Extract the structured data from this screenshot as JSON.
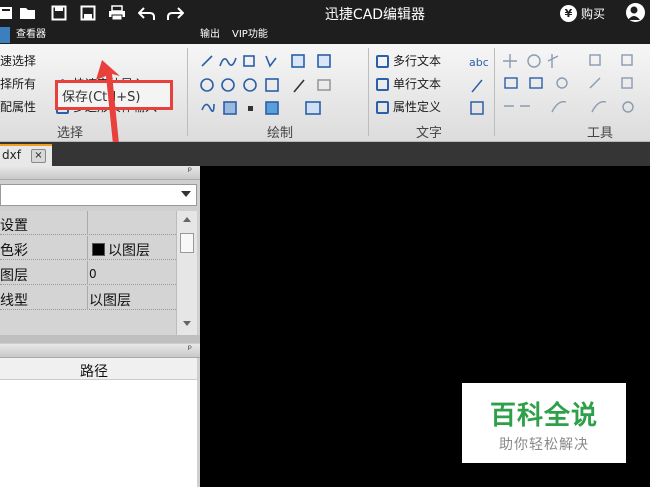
{
  "app": {
    "title": "迅捷CAD编辑器",
    "buy_label": "购买",
    "coin_symbol": "¥"
  },
  "tabs": [
    {
      "label": "查看器"
    },
    {
      "label": "输出"
    },
    {
      "label": "VIP功能"
    }
  ],
  "tooltip": {
    "text": "保存(Ctrl+S)"
  },
  "ribbon": {
    "select_group": {
      "label": "选择",
      "items": [
        "速选择",
        "择所有",
        "配属性"
      ],
      "items2": [
        "快速实体导入",
        "多边形实体输入"
      ]
    },
    "draw_group": {
      "label": "绘制"
    },
    "text_group": {
      "label": "文字",
      "items": [
        "多行文本",
        "单行文本",
        "属性定义"
      ]
    },
    "tools_group": {
      "label": "工具"
    }
  },
  "document_tab": {
    "name": "dxf",
    "close_glyph": "×"
  },
  "properties": {
    "pin_glyph": "ᵖ",
    "rows": [
      {
        "name": "设置",
        "value": ""
      },
      {
        "name": "色彩",
        "value": "以图层"
      },
      {
        "name": "图层",
        "value": "0"
      },
      {
        "name": "线型",
        "value": "以图层"
      }
    ]
  },
  "files_panel": {
    "path_header": "路径"
  },
  "watermark": {
    "title": "百科全说",
    "subtitle": "助你轻松解决"
  },
  "colors": {
    "highlight": "#e8403a",
    "accent": "#2fa04a",
    "title_bar": "#1e1e1e"
  }
}
